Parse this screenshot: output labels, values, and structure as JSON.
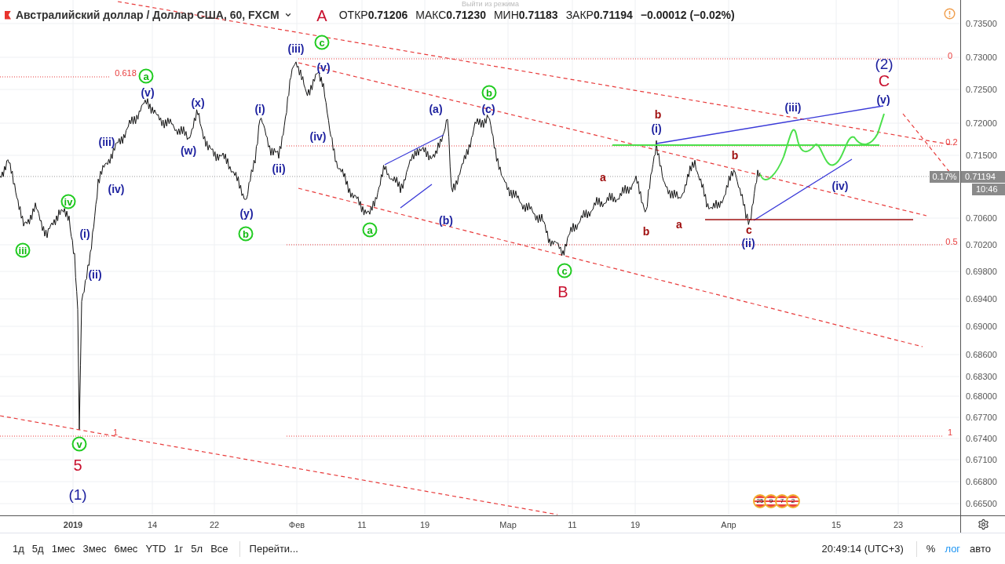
{
  "header": {
    "symbol": "Австралийский доллар / Доллар США, 60, FXCM",
    "ohlc": [
      {
        "label": "ОТКР",
        "value": "0.71206"
      },
      {
        "label": "МАКС",
        "value": "0.71230"
      },
      {
        "label": "МИН",
        "value": "0.71183"
      },
      {
        "label": "ЗАКР",
        "value": "0.71194"
      }
    ],
    "change": "−0.00012 (−0.02%)"
  },
  "overlay_hint": "Выйти из режима",
  "wave_labels": [
    {
      "text": "A",
      "kind": "red"
    },
    {
      "text": "(v)",
      "kind": "blue"
    },
    {
      "text": "(iii)",
      "kind": "blue"
    },
    {
      "text": "(iv)",
      "kind": "blue"
    },
    {
      "text": "(x)",
      "kind": "blue"
    },
    {
      "text": "(w)",
      "kind": "blue"
    },
    {
      "text": "(y)",
      "kind": "blue"
    },
    {
      "text": "(i)",
      "kind": "blue"
    },
    {
      "text": "(ii)",
      "kind": "blue"
    },
    {
      "text": "(iii)",
      "kind": "blue"
    },
    {
      "text": "(v)",
      "kind": "blue"
    },
    {
      "text": "(iv)",
      "kind": "blue"
    },
    {
      "text": "(i)",
      "kind": "blue"
    },
    {
      "text": "(ii)",
      "kind": "blue"
    },
    {
      "text": "(a)",
      "kind": "blue"
    },
    {
      "text": "(c)",
      "kind": "blue"
    },
    {
      "text": "(b)",
      "kind": "blue"
    },
    {
      "text": "(i)",
      "kind": "blue"
    },
    {
      "text": "(iii)",
      "kind": "blue"
    },
    {
      "text": "(v)",
      "kind": "blue"
    },
    {
      "text": "(iv)",
      "kind": "blue"
    },
    {
      "text": "(ii)",
      "kind": "blue"
    },
    {
      "text": "(2)",
      "kind": "navy"
    },
    {
      "text": "(1)",
      "kind": "navy"
    },
    {
      "text": "a",
      "kind": "green"
    },
    {
      "text": "iv",
      "kind": "green"
    },
    {
      "text": "iii",
      "kind": "green"
    },
    {
      "text": "v",
      "kind": "green"
    },
    {
      "text": "b",
      "kind": "green"
    },
    {
      "text": "c",
      "kind": "green"
    },
    {
      "text": "a",
      "kind": "green"
    },
    {
      "text": "b",
      "kind": "green"
    },
    {
      "text": "c",
      "kind": "green"
    },
    {
      "text": "B",
      "kind": "red"
    },
    {
      "text": "C",
      "kind": "red"
    },
    {
      "text": "5",
      "kind": "red"
    },
    {
      "text": "a",
      "kind": "maroon"
    },
    {
      "text": "b",
      "kind": "maroon"
    },
    {
      "text": "a",
      "kind": "maroon"
    },
    {
      "text": "b",
      "kind": "maroon"
    },
    {
      "text": "c",
      "kind": "maroon"
    },
    {
      "text": "b",
      "kind": "maroon"
    }
  ],
  "fib_levels": [
    {
      "text": "0"
    },
    {
      "text": "0.618"
    },
    {
      "text": "0.2"
    },
    {
      "text": "0.5"
    },
    {
      "text": "1"
    },
    {
      "text": "1"
    }
  ],
  "price_axis": {
    "ticks": [
      "0.73500",
      "0.73000",
      "0.72500",
      "0.72000",
      "0.71500",
      "0.70600",
      "0.70200",
      "0.69800",
      "0.69400",
      "0.69000",
      "0.68600",
      "0.68300",
      "0.68000",
      "0.67700",
      "0.67400",
      "0.67100",
      "0.66800",
      "0.66500"
    ],
    "last_price": "0.71194",
    "change_pct": "0.17%",
    "countdown": "10:46"
  },
  "time_axis": [
    {
      "label": "2019",
      "bold": true
    },
    {
      "label": "14",
      "bold": false
    },
    {
      "label": "22",
      "bold": false
    },
    {
      "label": "Фев",
      "bold": false
    },
    {
      "label": "11",
      "bold": false
    },
    {
      "label": "19",
      "bold": false
    },
    {
      "label": "Мар",
      "bold": false
    },
    {
      "label": "11",
      "bold": false
    },
    {
      "label": "19",
      "bold": false
    },
    {
      "label": "Апр",
      "bold": false
    },
    {
      "label": "15",
      "bold": false
    },
    {
      "label": "23",
      "bold": false
    }
  ],
  "events": [
    "25",
    "9",
    "7",
    "2"
  ],
  "toolbar": {
    "ranges": [
      "1д",
      "5д",
      "1мес",
      "3мес",
      "6мес",
      "YTD",
      "1г",
      "5л",
      "Все"
    ],
    "goto": "Перейти...",
    "clock": "20:49:14 (UTC+3)",
    "scale_buttons": [
      {
        "label": "%",
        "selected": false
      },
      {
        "label": "лог",
        "selected": true
      },
      {
        "label": "авто",
        "selected": false
      }
    ]
  }
}
